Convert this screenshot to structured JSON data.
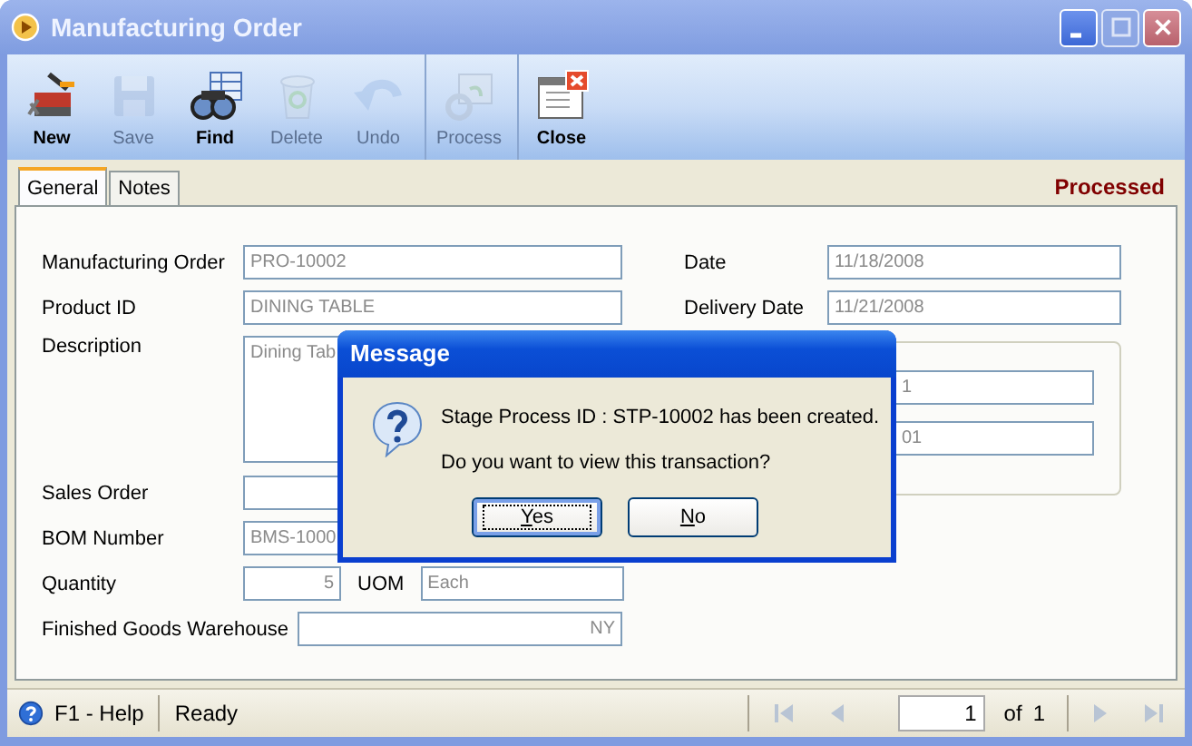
{
  "window": {
    "title": "Manufacturing Order",
    "controls": [
      {
        "kind": "minimize",
        "disabled": false
      },
      {
        "kind": "maximize",
        "disabled": true
      },
      {
        "kind": "close",
        "disabled": false
      }
    ]
  },
  "toolbar": [
    {
      "kind": "new",
      "label": "New",
      "disabled": false,
      "group_start": false
    },
    {
      "kind": "save",
      "label": "Save",
      "disabled": true,
      "group_start": false
    },
    {
      "kind": "find",
      "label": "Find",
      "disabled": false,
      "group_start": false
    },
    {
      "kind": "delete",
      "label": "Delete",
      "disabled": true,
      "group_start": false
    },
    {
      "kind": "undo",
      "label": "Undo",
      "disabled": true,
      "group_start": false
    },
    {
      "kind": "process",
      "label": "Process",
      "disabled": true,
      "group_start": true
    },
    {
      "kind": "close",
      "label": "Close",
      "disabled": false,
      "group_start": true
    }
  ],
  "tabs": [
    {
      "label": "General",
      "selected": true
    },
    {
      "label": "Notes",
      "selected": false
    }
  ],
  "status": "Processed",
  "form": {
    "manufacturing_order": {
      "label": "Manufacturing Order",
      "value": "PRO-10002"
    },
    "product_id": {
      "label": "Product ID",
      "value": "DINING TABLE"
    },
    "description": {
      "label": "Description",
      "value": "Dining Tab"
    },
    "sales_order": {
      "label": "Sales Order"
    },
    "bom_number": {
      "label": "BOM Number",
      "value": "BMS-1000"
    },
    "quantity": {
      "label": "Quantity",
      "value": "5"
    },
    "uom": {
      "label": "UOM",
      "value": "Each"
    },
    "warehouse": {
      "label": "Finished Goods Warehouse",
      "value": "NY"
    },
    "date": {
      "label": "Date",
      "value": "11/18/2008"
    },
    "delivery_date": {
      "label": "Delivery Date",
      "value": "11/21/2008"
    },
    "group_fields": [
      {
        "value": "1"
      },
      {
        "value": "01"
      }
    ]
  },
  "dialog": {
    "title": "Message",
    "lines": [
      "Stage Process ID : STP-10002 has been created.",
      "Do you want to view this transaction?"
    ],
    "buttons": [
      {
        "label": "Yes",
        "selected": true
      },
      {
        "label": "No",
        "selected": false
      }
    ]
  },
  "status_bar": {
    "help": "F1 - Help",
    "message": "Ready",
    "page": "1",
    "of_label": "of",
    "total": "1",
    "nav_before": [
      {
        "kind": "first",
        "disabled": true
      },
      {
        "kind": "prev",
        "disabled": true
      }
    ],
    "nav_after": [
      {
        "kind": "next",
        "disabled": true
      },
      {
        "kind": "last",
        "disabled": true
      }
    ]
  }
}
